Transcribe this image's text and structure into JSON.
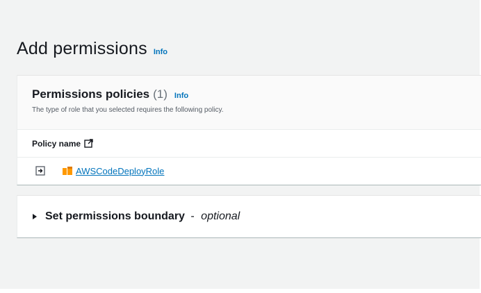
{
  "header": {
    "title": "Add permissions",
    "info_label": "Info"
  },
  "policies_panel": {
    "title": "Permissions policies",
    "count": "(1)",
    "info_label": "Info",
    "description": "The type of role that you selected requires the following policy.",
    "column_header": "Policy name",
    "rows": [
      {
        "policy_name": "AWSCodeDeployRole",
        "icon": "aws-managed-policy-icon"
      }
    ]
  },
  "boundary_section": {
    "label": "Set permissions boundary",
    "dash": "-",
    "optional_label": "optional"
  },
  "colors": {
    "link": "#0073bb",
    "policy_icon": "#ff9900",
    "background": "#f2f3f3"
  }
}
